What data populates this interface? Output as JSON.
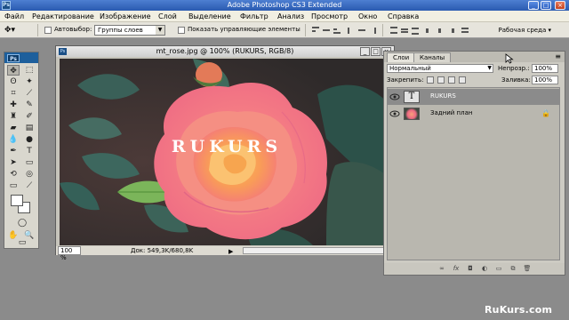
{
  "titlebar": {
    "title": "Adobe Photoshop CS3 Extended",
    "app_icon": "Ps"
  },
  "menu": [
    "Файл",
    "Редактирование",
    "Изображение",
    "Слой",
    "Выделение",
    "Фильтр",
    "Анализ",
    "Просмотр",
    "Окно",
    "Справка"
  ],
  "options": {
    "autoselect_label": "Автовыбор:",
    "autoselect_value": "Группы слоев",
    "show_controls_label": "Показать управляющие элементы",
    "workspace_label": "Рабочая среда ▾"
  },
  "toolbox": {
    "badge": "Ps"
  },
  "document": {
    "title": "mt_rose.jpg @ 100% (RUKURS, RGB/8)",
    "canvas_text": "RUKURS",
    "zoom": "100 %",
    "info": "Док: 549,3K/680,8K"
  },
  "layers_panel": {
    "tabs": [
      "Слои",
      "Каналы"
    ],
    "blend_mode": "Нормальный",
    "opacity_label": "Непрозр.:",
    "opacity_value": "100%",
    "lock_label": "Закрепить:",
    "fill_label": "Заливка:",
    "fill_value": "100%",
    "layers": [
      {
        "name": "RUKURS",
        "thumb": "T",
        "selected": true
      },
      {
        "name": "Задний план",
        "thumb": "image",
        "selected": false
      }
    ],
    "footer_icons": [
      "link-icon",
      "fx-icon",
      "mask-icon",
      "adjustment-icon",
      "folder-icon",
      "new-layer-icon",
      "trash-icon"
    ]
  },
  "watermark": "RuKurs.com",
  "colors": {
    "title_blue": "#2a5ab0",
    "ps_blue": "#1d5f9c",
    "selected_layer": "#8b8b8b",
    "workspace_gray": "#8b8b8b"
  }
}
